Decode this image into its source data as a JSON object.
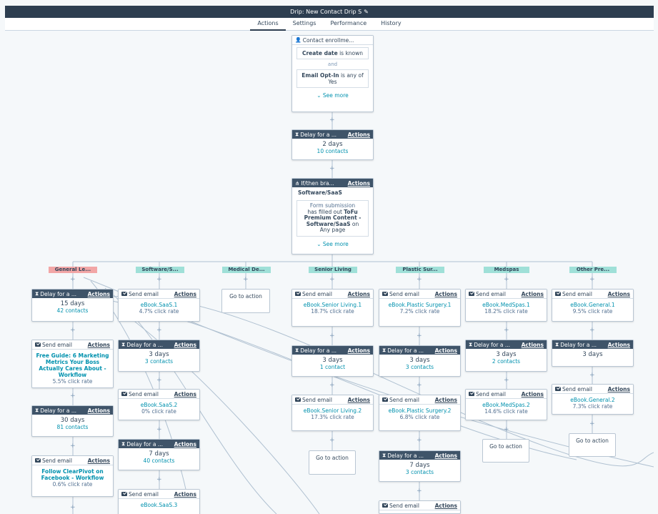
{
  "app": {
    "title": "Drip: New Contact Drip S"
  },
  "tabs": [
    "Actions",
    "Settings",
    "Performance",
    "History"
  ],
  "enroll": {
    "header": "Contact enrollme...",
    "cond1_field": "Create date",
    "cond1_rest": " is known",
    "and_label": "and",
    "cond2_field": "Email Opt-In",
    "cond2_rest": " is any of Yes",
    "see_more": "See more"
  },
  "delay_main": {
    "header": "Delay for a ...",
    "actions": "Actions",
    "days": "2 days",
    "contacts": "10 contacts"
  },
  "ifthen": {
    "header": "If/then bra...",
    "actions": "Actions",
    "branch_name": "Software/SaaS",
    "line1": "Form submission",
    "line2": "has filled out",
    "line2b": "ToFu Premium Content - Software/SaaS",
    "line3": " on",
    "line4": "Any page",
    "see_more": "See more"
  },
  "branches": [
    "General Le...",
    "Software/S...",
    "Medical De...",
    "Senior Living",
    "Plastic Sur...",
    "Medspas",
    "Other Pre..."
  ],
  "labels": {
    "send_email": "Send email",
    "delay": "Delay for a ...",
    "actions": "Actions",
    "goto": "Go to action"
  },
  "col1": {
    "delay1": {
      "days": "15 days",
      "contacts": "42 contacts"
    },
    "email1": {
      "name": "Free Guide: 6 Marketing Metrics Your Boss Actually Cares About - Workflow",
      "rate": "5.5% click rate"
    },
    "delay2": {
      "days": "30 days",
      "contacts": "81 contacts"
    },
    "email2": {
      "name": "Follow ClearPivot on Facebook - Workflow",
      "rate": "0.6% click rate"
    }
  },
  "col2": {
    "email1": {
      "name": "eBook.SaaS.1",
      "rate": "4.7% click rate"
    },
    "delay1": {
      "days": "3 days",
      "contacts": "3 contacts"
    },
    "email2": {
      "name": "eBook.SaaS.2",
      "rate": "0% click rate"
    },
    "delay2": {
      "days": "7 days",
      "contacts": "40 contacts"
    },
    "email3": {
      "name": "eBook.SaaS.3"
    }
  },
  "col4": {
    "email1": {
      "name": "eBook.Senior Living.1",
      "rate": "18.7% click rate"
    },
    "delay1": {
      "days": "3 days",
      "contacts": "1 contact"
    },
    "email2": {
      "name": "eBook.Senior Living.2",
      "rate": "17.3% click rate"
    }
  },
  "col5": {
    "email1": {
      "name": "eBook.Plastic Surgery.1",
      "rate": "7.2% click rate"
    },
    "delay1": {
      "days": "3 days",
      "contacts": "3 contacts"
    },
    "email2": {
      "name": "eBook.Plastic Surgery.2",
      "rate": "6.8% click rate"
    },
    "delay2": {
      "days": "7 days",
      "contacts": "3 contacts"
    }
  },
  "col6": {
    "email1": {
      "name": "eBook.MedSpas.1",
      "rate": "18.2% click rate"
    },
    "delay1": {
      "days": "3 days",
      "contacts": "2 contacts"
    },
    "email2": {
      "name": "eBook.MedSpas.2",
      "rate": "14.6% click rate"
    }
  },
  "col7": {
    "email1": {
      "name": "eBook.General.1",
      "rate": "9.5% click rate"
    },
    "delay1": {
      "days": "3 days"
    },
    "email2": {
      "name": "eBook.General.2",
      "rate": "7.3% click rate"
    }
  },
  "colors": {
    "topbar": "#2d3e50",
    "link": "#0091ae",
    "branch_red": "#f2a6a6",
    "branch_teal": "#9fe0d8"
  }
}
